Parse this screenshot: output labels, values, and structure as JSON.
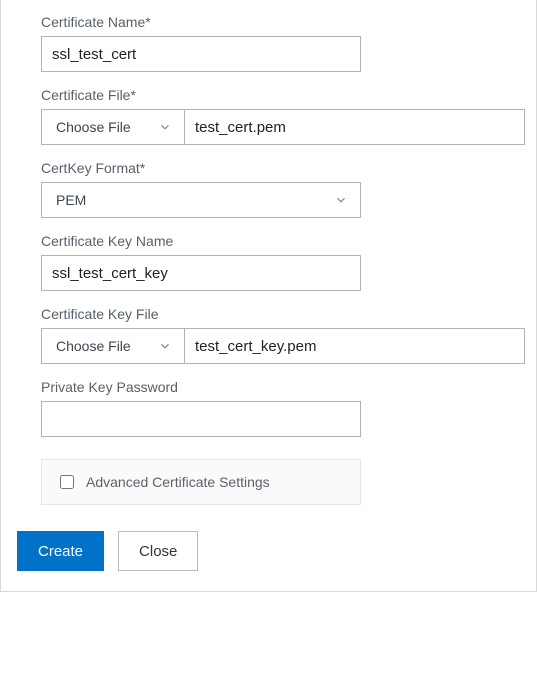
{
  "form": {
    "cert_name": {
      "label": "Certificate Name*",
      "value": "ssl_test_cert"
    },
    "cert_file": {
      "label": "Certificate File*",
      "choose_label": "Choose File",
      "value": "test_cert.pem"
    },
    "certkey_format": {
      "label": "CertKey Format*",
      "value": "PEM"
    },
    "cert_key_name": {
      "label": "Certificate Key Name",
      "value": "ssl_test_cert_key"
    },
    "cert_key_file": {
      "label": "Certificate Key File",
      "choose_label": "Choose File",
      "value": "test_cert_key.pem"
    },
    "priv_key_pw": {
      "label": "Private Key Password",
      "value": ""
    },
    "advanced": {
      "label": "Advanced Certificate Settings"
    }
  },
  "buttons": {
    "create": "Create",
    "close": "Close"
  }
}
